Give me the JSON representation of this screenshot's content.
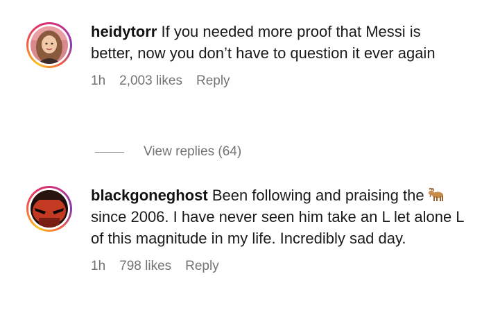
{
  "comments": [
    {
      "username": "heidytorr",
      "text": "If you needed more proof that Messi is better, now you don’t have to question it ever again",
      "time": "1h",
      "likes": "2,003 likes",
      "reply_label": "Reply"
    },
    {
      "username": "blackgoneghost",
      "text_before_emoji": "Been following and praising the",
      "emoji_icon": "goat-emoji",
      "text_after_emoji": "since 2006. I have never seen him take an L let alone L of this magnitude in my life. Incredibly sad day.",
      "time": "1h",
      "likes": "798 likes",
      "reply_label": "Reply"
    }
  ],
  "view_replies": {
    "label": "View replies (64)"
  },
  "colors": {
    "meta_text": "#737373",
    "story_ring_start": "#f9c31f",
    "story_ring_end": "#c13584"
  }
}
